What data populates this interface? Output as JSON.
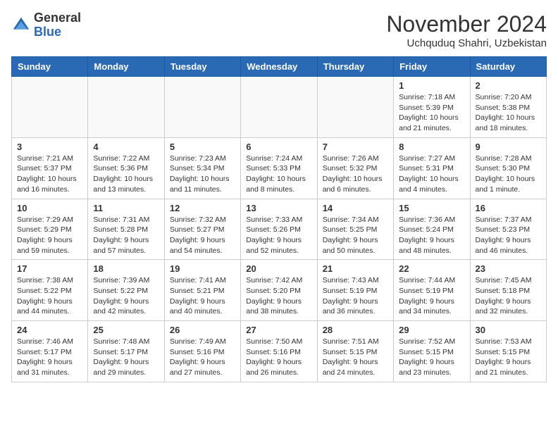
{
  "header": {
    "logo_line1": "General",
    "logo_line2": "Blue",
    "month_title": "November 2024",
    "location": "Uchquduq Shahri, Uzbekistan"
  },
  "columns": [
    "Sunday",
    "Monday",
    "Tuesday",
    "Wednesday",
    "Thursday",
    "Friday",
    "Saturday"
  ],
  "weeks": [
    [
      {
        "day": "",
        "info": ""
      },
      {
        "day": "",
        "info": ""
      },
      {
        "day": "",
        "info": ""
      },
      {
        "day": "",
        "info": ""
      },
      {
        "day": "",
        "info": ""
      },
      {
        "day": "1",
        "info": "Sunrise: 7:18 AM\nSunset: 5:39 PM\nDaylight: 10 hours and 21 minutes."
      },
      {
        "day": "2",
        "info": "Sunrise: 7:20 AM\nSunset: 5:38 PM\nDaylight: 10 hours and 18 minutes."
      }
    ],
    [
      {
        "day": "3",
        "info": "Sunrise: 7:21 AM\nSunset: 5:37 PM\nDaylight: 10 hours and 16 minutes."
      },
      {
        "day": "4",
        "info": "Sunrise: 7:22 AM\nSunset: 5:36 PM\nDaylight: 10 hours and 13 minutes."
      },
      {
        "day": "5",
        "info": "Sunrise: 7:23 AM\nSunset: 5:34 PM\nDaylight: 10 hours and 11 minutes."
      },
      {
        "day": "6",
        "info": "Sunrise: 7:24 AM\nSunset: 5:33 PM\nDaylight: 10 hours and 8 minutes."
      },
      {
        "day": "7",
        "info": "Sunrise: 7:26 AM\nSunset: 5:32 PM\nDaylight: 10 hours and 6 minutes."
      },
      {
        "day": "8",
        "info": "Sunrise: 7:27 AM\nSunset: 5:31 PM\nDaylight: 10 hours and 4 minutes."
      },
      {
        "day": "9",
        "info": "Sunrise: 7:28 AM\nSunset: 5:30 PM\nDaylight: 10 hours and 1 minute."
      }
    ],
    [
      {
        "day": "10",
        "info": "Sunrise: 7:29 AM\nSunset: 5:29 PM\nDaylight: 9 hours and 59 minutes."
      },
      {
        "day": "11",
        "info": "Sunrise: 7:31 AM\nSunset: 5:28 PM\nDaylight: 9 hours and 57 minutes."
      },
      {
        "day": "12",
        "info": "Sunrise: 7:32 AM\nSunset: 5:27 PM\nDaylight: 9 hours and 54 minutes."
      },
      {
        "day": "13",
        "info": "Sunrise: 7:33 AM\nSunset: 5:26 PM\nDaylight: 9 hours and 52 minutes."
      },
      {
        "day": "14",
        "info": "Sunrise: 7:34 AM\nSunset: 5:25 PM\nDaylight: 9 hours and 50 minutes."
      },
      {
        "day": "15",
        "info": "Sunrise: 7:36 AM\nSunset: 5:24 PM\nDaylight: 9 hours and 48 minutes."
      },
      {
        "day": "16",
        "info": "Sunrise: 7:37 AM\nSunset: 5:23 PM\nDaylight: 9 hours and 46 minutes."
      }
    ],
    [
      {
        "day": "17",
        "info": "Sunrise: 7:38 AM\nSunset: 5:22 PM\nDaylight: 9 hours and 44 minutes."
      },
      {
        "day": "18",
        "info": "Sunrise: 7:39 AM\nSunset: 5:22 PM\nDaylight: 9 hours and 42 minutes."
      },
      {
        "day": "19",
        "info": "Sunrise: 7:41 AM\nSunset: 5:21 PM\nDaylight: 9 hours and 40 minutes."
      },
      {
        "day": "20",
        "info": "Sunrise: 7:42 AM\nSunset: 5:20 PM\nDaylight: 9 hours and 38 minutes."
      },
      {
        "day": "21",
        "info": "Sunrise: 7:43 AM\nSunset: 5:19 PM\nDaylight: 9 hours and 36 minutes."
      },
      {
        "day": "22",
        "info": "Sunrise: 7:44 AM\nSunset: 5:19 PM\nDaylight: 9 hours and 34 minutes."
      },
      {
        "day": "23",
        "info": "Sunrise: 7:45 AM\nSunset: 5:18 PM\nDaylight: 9 hours and 32 minutes."
      }
    ],
    [
      {
        "day": "24",
        "info": "Sunrise: 7:46 AM\nSunset: 5:17 PM\nDaylight: 9 hours and 31 minutes."
      },
      {
        "day": "25",
        "info": "Sunrise: 7:48 AM\nSunset: 5:17 PM\nDaylight: 9 hours and 29 minutes."
      },
      {
        "day": "26",
        "info": "Sunrise: 7:49 AM\nSunset: 5:16 PM\nDaylight: 9 hours and 27 minutes."
      },
      {
        "day": "27",
        "info": "Sunrise: 7:50 AM\nSunset: 5:16 PM\nDaylight: 9 hours and 26 minutes."
      },
      {
        "day": "28",
        "info": "Sunrise: 7:51 AM\nSunset: 5:15 PM\nDaylight: 9 hours and 24 minutes."
      },
      {
        "day": "29",
        "info": "Sunrise: 7:52 AM\nSunset: 5:15 PM\nDaylight: 9 hours and 23 minutes."
      },
      {
        "day": "30",
        "info": "Sunrise: 7:53 AM\nSunset: 5:15 PM\nDaylight: 9 hours and 21 minutes."
      }
    ]
  ]
}
